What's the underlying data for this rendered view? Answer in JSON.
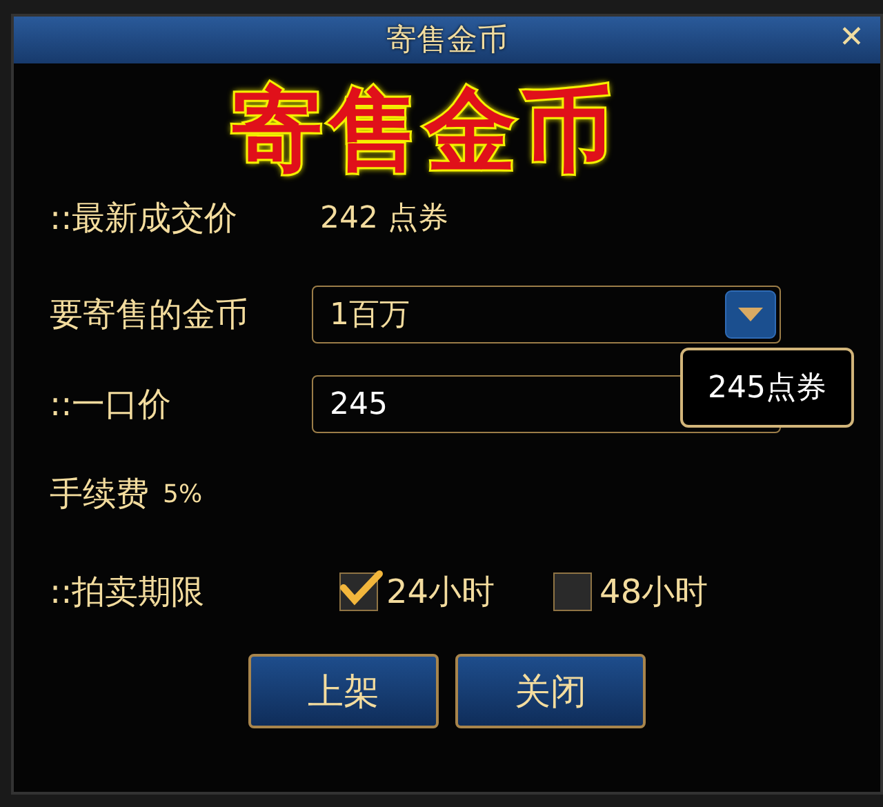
{
  "window": {
    "title": "寄售金币",
    "close": "✕"
  },
  "caption": "寄售金币",
  "latest_price": {
    "label": "::最新成交价",
    "value": "242 点券"
  },
  "gold_select": {
    "label": "要寄售的金币",
    "value": "1百万"
  },
  "buyout": {
    "label": "::一口价",
    "value": "245",
    "tooltip": "245点券"
  },
  "fee": {
    "label": "手续费",
    "value": "5%"
  },
  "duration": {
    "label": "::拍卖期限",
    "options": [
      {
        "label": "24小时",
        "checked": true
      },
      {
        "label": "48小时",
        "checked": false
      }
    ]
  },
  "buttons": [
    "上架",
    "关闭"
  ]
}
